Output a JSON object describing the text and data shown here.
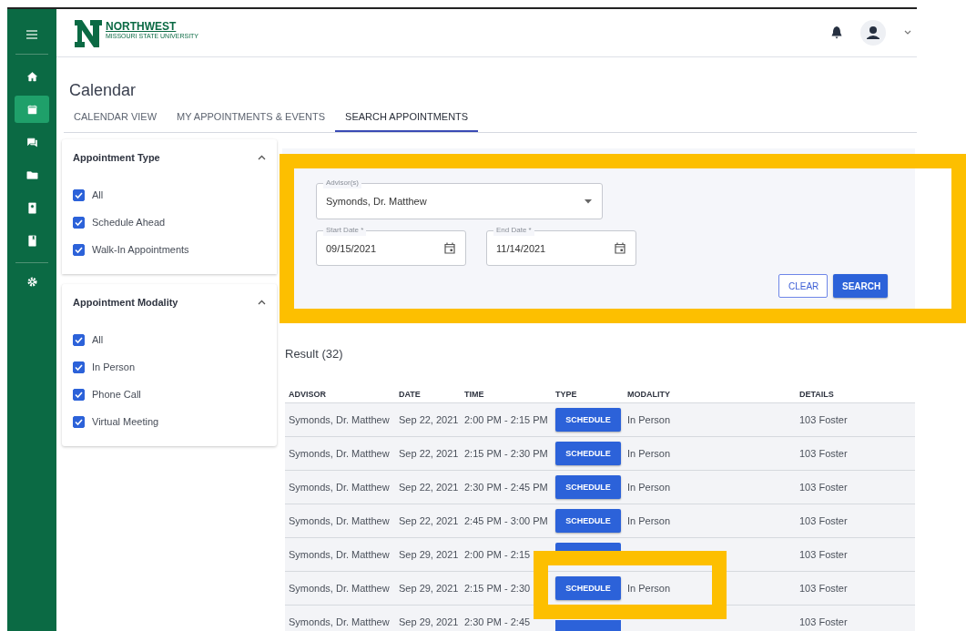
{
  "brand": {
    "name": "NORTHWEST",
    "subtitle": "MISSOURI STATE UNIVERSITY"
  },
  "rail": [
    {
      "selected": false
    },
    {
      "selected": true
    },
    {
      "selected": false
    },
    {
      "selected": false
    },
    {
      "selected": false
    },
    {
      "selected": false
    }
  ],
  "page_title": "Calendar",
  "tabs": [
    {
      "label": "CALENDAR VIEW",
      "selected": false
    },
    {
      "label": "MY APPOINTMENTS & EVENTS",
      "selected": false
    },
    {
      "label": "SEARCH APPOINTMENTS",
      "selected": true
    }
  ],
  "filters": [
    {
      "title": "Appointment Type",
      "expanded": true,
      "options": [
        {
          "label": "All",
          "checked": true
        },
        {
          "label": "Schedule Ahead",
          "checked": true
        },
        {
          "label": "Walk-In Appointments",
          "checked": true
        }
      ]
    },
    {
      "title": "Appointment Modality",
      "expanded": true,
      "options": [
        {
          "label": "All",
          "checked": true
        },
        {
          "label": "In Person",
          "checked": true
        },
        {
          "label": "Phone Call",
          "checked": true
        },
        {
          "label": "Virtual Meeting",
          "checked": true
        }
      ]
    }
  ],
  "search": {
    "advisor": {
      "label": "Advisor(s)",
      "value": "Symonds, Dr. Matthew"
    },
    "start_date": {
      "label": "Start Date *",
      "value": "09/15/2021"
    },
    "end_date": {
      "label": "End Date *",
      "value": "11/14/2021"
    },
    "buttons": [
      "CLEAR",
      "SEARCH"
    ]
  },
  "result_title": "Result (32)",
  "table": {
    "columns": [
      "ADVISOR",
      "DATE",
      "TIME",
      "TYPE",
      "MODALITY",
      "DETAILS"
    ],
    "rows": [
      {
        "advisor": "Symonds, Dr. Matthew",
        "date": "Sep 22, 2021",
        "time": "2:00 PM - 2:15 PM",
        "type": "SCHEDULE",
        "modality": "In Person",
        "details": "103 Foster"
      },
      {
        "advisor": "Symonds, Dr. Matthew",
        "date": "Sep 22, 2021",
        "time": "2:15 PM - 2:30 PM",
        "type": "SCHEDULE",
        "modality": "In Person",
        "details": "103 Foster"
      },
      {
        "advisor": "Symonds, Dr. Matthew",
        "date": "Sep 22, 2021",
        "time": "2:30 PM - 2:45 PM",
        "type": "SCHEDULE",
        "modality": "In Person",
        "details": "103 Foster"
      },
      {
        "advisor": "Symonds, Dr. Matthew",
        "date": "Sep 22, 2021",
        "time": "2:45 PM - 3:00 PM",
        "type": "SCHEDULE",
        "modality": "In Person",
        "details": "103 Foster"
      },
      {
        "advisor": "Symonds, Dr. Matthew",
        "date": "Sep 29, 2021",
        "time": "2:00 PM - 2:15",
        "details": "103 Foster"
      },
      {
        "advisor": "Symonds, Dr. Matthew",
        "date": "Sep 29, 2021",
        "time": "2:15 PM - 2:30",
        "type": "SCHEDULE",
        "modality": "In Person",
        "details": "103 Foster"
      },
      {
        "advisor": "Symonds, Dr. Matthew",
        "date": "Sep 29, 2021",
        "time": "2:30 PM - 2:45",
        "details": "103 Foster"
      }
    ]
  }
}
